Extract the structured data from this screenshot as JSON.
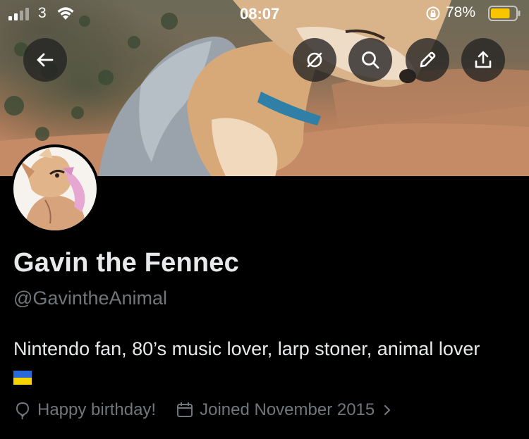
{
  "status_bar": {
    "carrier": "3",
    "time": "08:07",
    "battery_percent": "78%",
    "battery_level": 0.78,
    "battery_color": "#f7c600"
  },
  "header_buttons": {
    "back": "arrow-left-icon",
    "grok": "grok-icon",
    "search": "search-icon",
    "edit": "pencil-icon",
    "share": "share-icon"
  },
  "profile": {
    "display_name": "Gavin the Fennec",
    "handle": "@GavintheAnimal",
    "bio": "Nintendo fan, 80’s music lover, larp stoner, animal lover",
    "bio_emoji": "ukraine-flag",
    "birthday": "Happy birthday!",
    "joined": "Joined November 2015"
  },
  "colors": {
    "background": "#000000",
    "primary_text": "#e7e9ea",
    "secondary_text": "#71767b"
  }
}
